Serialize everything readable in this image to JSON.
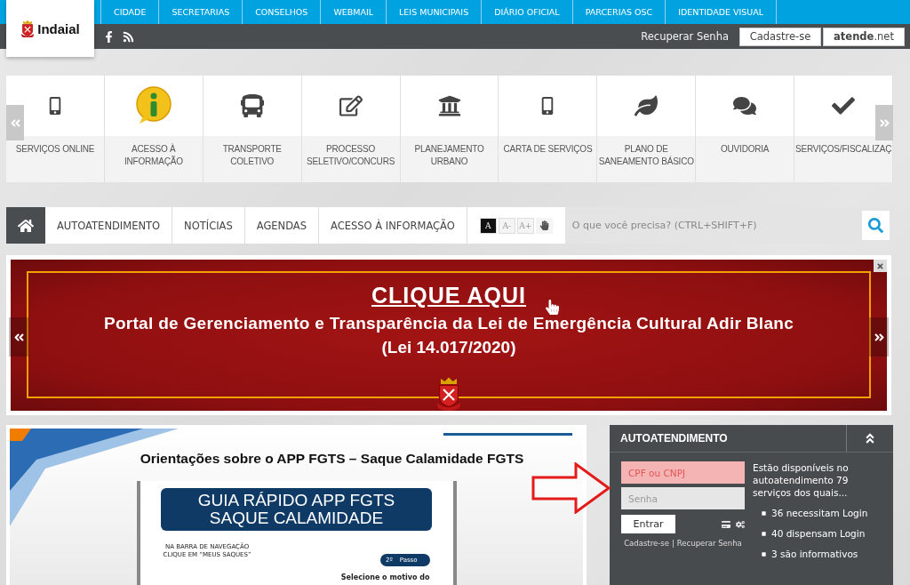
{
  "logo": {
    "name": "Indaial"
  },
  "top_nav": [
    {
      "label": "CIDADE"
    },
    {
      "label": "SECRETARIAS"
    },
    {
      "label": "CONSELHOS"
    },
    {
      "label": "WEBMAIL"
    },
    {
      "label": "LEIS MUNICIPAIS"
    },
    {
      "label": "DIÁRIO OFICIAL"
    },
    {
      "label": "PARCERIAS OSC"
    },
    {
      "label": "IDENTIDADE VISUAL"
    }
  ],
  "account_bar": {
    "recover": "Recuperar Senha",
    "signup": "Cadastre-se",
    "portal": "**atende**.net"
  },
  "services": [
    {
      "label": "SERVIÇOS ONLINE",
      "kind": "phone"
    },
    {
      "label": "ACESSO À INFORMAÇÃO",
      "kind": "info"
    },
    {
      "label": "TRANSPORTE COLETIVO",
      "kind": "bus"
    },
    {
      "label": "PROCESSO SELETIVO/CONCURS",
      "kind": "edit"
    },
    {
      "label": "PLANEJAMENTO URBANO",
      "kind": "bank"
    },
    {
      "label": "CARTA DE SERVIÇOS",
      "kind": "phone"
    },
    {
      "label": "PLANO DE SANEAMENTO BÁSICO",
      "kind": "leaf"
    },
    {
      "label": "OUVIDORIA",
      "kind": "chat"
    },
    {
      "label": "SERVIÇOS/FISCALIZAÇ",
      "kind": "check"
    }
  ],
  "main_nav": {
    "items": [
      {
        "label": "AUTOATENDIMENTO"
      },
      {
        "label": "NOTÍCIAS"
      },
      {
        "label": "AGENDAS"
      },
      {
        "label": "ACESSO À INFORMAÇÃO"
      }
    ],
    "font_controls": [
      {
        "label": "A",
        "selected": true
      },
      {
        "label": "A-",
        "selected": false
      },
      {
        "label": "A+",
        "selected": false
      }
    ],
    "search": {
      "placeholder": "O que você precisa? (CTRL+SHIFT+F)"
    }
  },
  "banner": {
    "link": "CLIQUE AQUI",
    "title": "Portal de Gerenciamento e Transparência da Lei de Emergência Cultural Adir Blanc",
    "subtitle": "(Lei 14.017/2020)"
  },
  "video": {
    "title": "Orientações sobre o APP FGTS – Saque Calamidade FGTS",
    "guide": [
      "GUIA RÁPIDO APP FGTS",
      "SAQUE CALAMIDADE"
    ],
    "note": [
      "NA BARRA DE NAVEGAÇÃO",
      "CLIQUE EM “MEUS SAQUES”"
    ],
    "step_number": "2º",
    "step_label": "Passo",
    "step_hint": "Selecione o motivo do"
  },
  "login": {
    "title": "AUTOATENDIMENTO",
    "cpf": {
      "placeholder": "CPF ou CNPJ",
      "invalid": true
    },
    "password": {
      "placeholder": "Senha"
    },
    "submit": "Entrar",
    "links": [
      "Cadastre-se",
      "Recuperar Senha"
    ],
    "separator": "|",
    "intro": "Estão disponíveis no autoatendimento 79 serviços dos quais...",
    "stats": [
      "36 necessitam Login",
      "40 dispensam Login",
      "3 são informativos"
    ]
  }
}
